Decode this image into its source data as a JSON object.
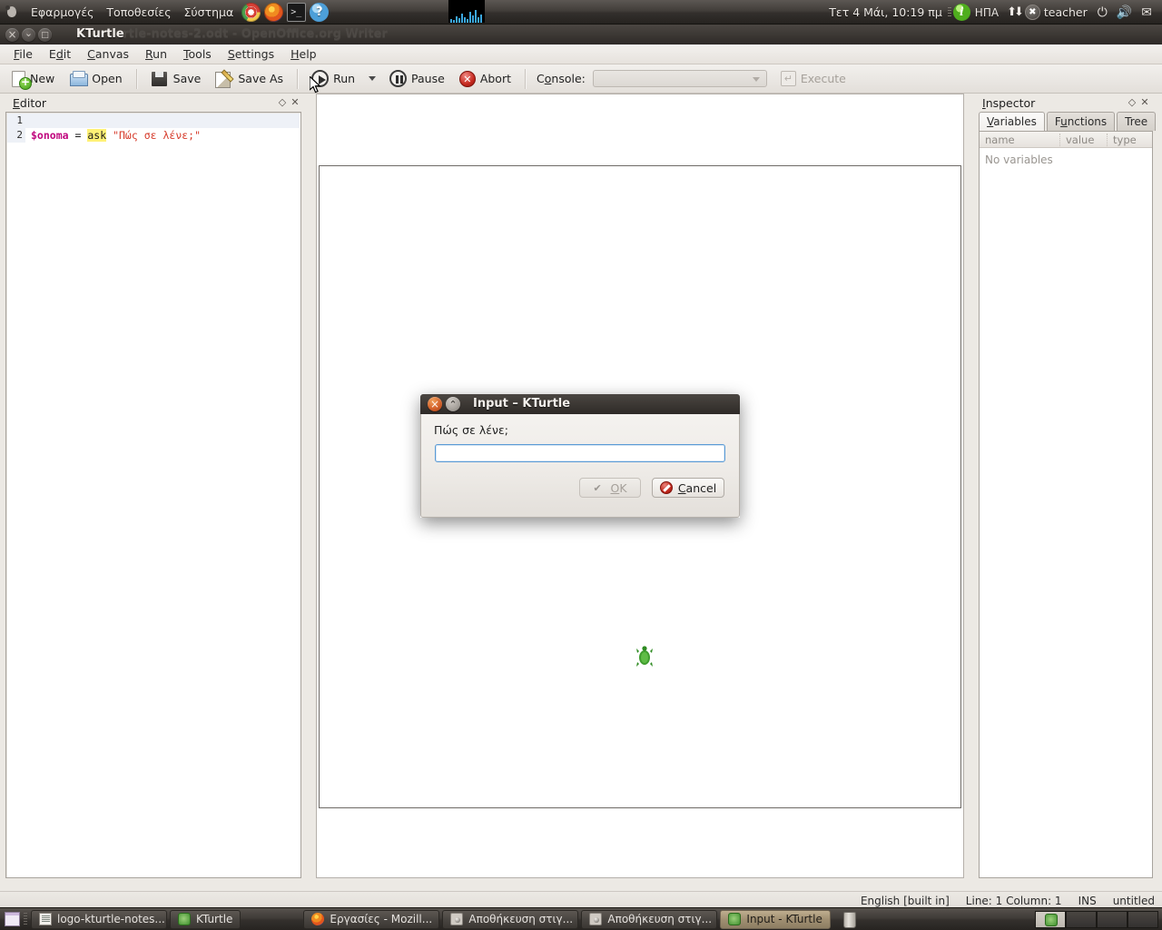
{
  "desktop": {
    "top_panel": {
      "menus": [
        "Εφαρμογές",
        "Τοποθεσίες",
        "Σύστημα"
      ],
      "launchers": [
        {
          "name": "chrome-icon",
          "label": "Chrome"
        },
        {
          "name": "firefox-icon",
          "label": "Firefox"
        },
        {
          "name": "terminal-icon",
          "label": "Terminal"
        },
        {
          "name": "help-icon",
          "label": "?"
        }
      ],
      "clock": "Τετ  4 Μάι, 10:19 πμ",
      "keyboard_layout": "ΗΠΑ",
      "user": "teacher",
      "tray_icons": [
        "info-icon",
        "network-icon",
        "user-icon",
        "power-icon",
        "volume-icon",
        "mail-icon"
      ]
    },
    "taskbar": {
      "items": [
        {
          "label": "logo-kturtle-notes...",
          "icon": "document-icon",
          "active": false
        },
        {
          "label": "KTurtle",
          "icon": "kturtle-icon",
          "active": false
        },
        {
          "label": "Εργασίες - Mozill...",
          "icon": "firefox-icon",
          "active": false
        },
        {
          "label": "Αποθήκευση στιγ...",
          "icon": "screenshot-icon",
          "active": false
        },
        {
          "label": "Αποθήκευση στιγ...",
          "icon": "screenshot-icon",
          "active": false
        },
        {
          "label": "Input - KTurtle",
          "icon": "kturtle-icon",
          "active": true
        }
      ],
      "trash": "trash-icon",
      "workspaces": 4,
      "active_workspace": 1
    }
  },
  "window": {
    "title": "KTurtle",
    "background_title": "urtle-notes-2.odt - OpenOffice.org Writer",
    "menubar": [
      {
        "label": "File",
        "accel": "F"
      },
      {
        "label": "Edit",
        "accel": "d"
      },
      {
        "label": "Canvas",
        "accel": "C"
      },
      {
        "label": "Run",
        "accel": "R"
      },
      {
        "label": "Tools",
        "accel": "T"
      },
      {
        "label": "Settings",
        "accel": "S"
      },
      {
        "label": "Help",
        "accel": "H"
      }
    ],
    "toolbar": {
      "new": "New",
      "open": "Open",
      "save": "Save",
      "save_as": "Save As",
      "run": "Run",
      "pause": "Pause",
      "abort": "Abort",
      "console_label": "Console:",
      "console_value": "",
      "console_placeholder": "",
      "execute": "Execute"
    }
  },
  "editor": {
    "title": "Editor",
    "lines": [
      {
        "number": "1",
        "content": ""
      },
      {
        "number": "2",
        "content": "$onoma = ask \"Πώς σε λένε;\""
      }
    ],
    "tokens": {
      "variable": "$onoma",
      "equals": "=",
      "command": "ask",
      "string": "\"Πώς σε λένε;\""
    },
    "colors": {
      "variable": "#c0077e",
      "command_highlight": "#fff176",
      "string": "#d63a2a"
    }
  },
  "inspector": {
    "title": "Inspector",
    "tabs": [
      {
        "label": "Variables",
        "active": true
      },
      {
        "label": "Functions",
        "active": false
      },
      {
        "label": "Tree",
        "active": false
      }
    ],
    "columns": [
      "name",
      "value",
      "type"
    ],
    "empty_text": "No variables"
  },
  "statusbar": {
    "language": "English [built in]",
    "position": "Line: 1 Column: 1",
    "insert_mode": "INS",
    "filename": "untitled"
  },
  "dialog": {
    "title": "Input – KTurtle",
    "prompt": "Πώς σε λένε;",
    "input_value": "",
    "input_placeholder": "",
    "ok_label": "OK",
    "ok_accel": "O",
    "ok_disabled": true,
    "cancel_label": "Cancel",
    "cancel_accel": "C"
  }
}
